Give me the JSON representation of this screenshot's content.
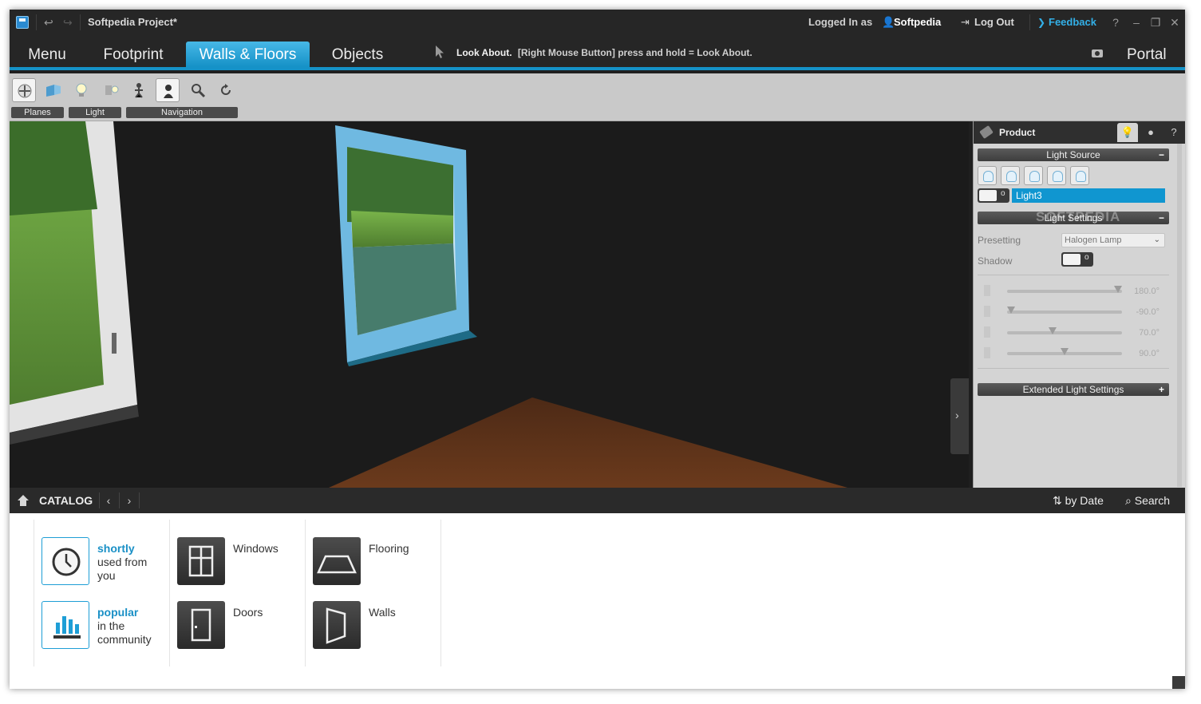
{
  "titlebar": {
    "project_title": "Softpedia Project*",
    "logged_label": "Logged In as",
    "user_name": "Softpedia",
    "logout_label": "Log Out",
    "feedback_label": "Feedback",
    "help": "?"
  },
  "tabs": [
    {
      "label": "Menu"
    },
    {
      "label": "Footprint"
    },
    {
      "label": "Walls & Floors"
    },
    {
      "label": "Objects"
    }
  ],
  "hint": {
    "title": "Look About.",
    "text": "[Right Mouse Button] press and hold = Look About."
  },
  "portal_label": "Portal",
  "toolbar": {
    "groups": [
      {
        "label": "Planes"
      },
      {
        "label": "Light"
      },
      {
        "label": "Navigation"
      }
    ],
    "tool_icons": [
      "move-planes-icon",
      "wall-edit-icon",
      "light-bulb-icon",
      "light-list-icon",
      "walk-icon",
      "look-about-icon",
      "zoom-icon",
      "reset-view-icon"
    ]
  },
  "panel": {
    "product_label": "Product",
    "help": "?",
    "light_source_title": "Light Source",
    "light_name": "Light3",
    "light_settings_title": "Light Settings",
    "watermark": "SOFTPEDIA",
    "presetting_label": "Presetting",
    "presetting_value": "Halogen Lamp",
    "shadow_label": "Shadow",
    "toggle_off": "o",
    "angles": [
      {
        "value": "180.0°",
        "level": 1.0
      },
      {
        "value": "-90.0°",
        "level": 0.0
      },
      {
        "value": "70.0°",
        "level": 0.39
      },
      {
        "value": "90.0°",
        "level": 0.5
      }
    ],
    "extended_title": "Extended Light Settings",
    "minus": "−",
    "plus": "+"
  },
  "catalog": {
    "label": "CATALOG",
    "prev": "‹",
    "next": "›",
    "sort_label": "by Date",
    "search_label": "Search",
    "shortly": {
      "title": "shortly",
      "line1": "used from",
      "line2": "you"
    },
    "popular": {
      "title": "popular",
      "line1": "in the",
      "line2": "community"
    },
    "items": [
      {
        "label": "Windows"
      },
      {
        "label": "Doors"
      },
      {
        "label": "Flooring"
      },
      {
        "label": "Walls"
      }
    ]
  },
  "colors": {
    "accent": "#1592c8",
    "feedback": "#33b0e8",
    "selected_light": "#1096d0",
    "catalog_title": "#1a90c6"
  }
}
